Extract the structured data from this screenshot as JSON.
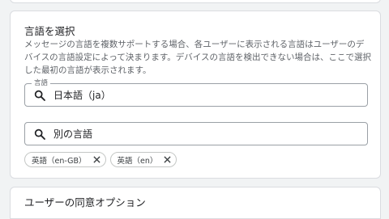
{
  "section": {
    "title": "言語を選択",
    "description": "メッセージの言語を複数サポートする場合、各ユーザーに表示される言語はユーザーのデバイスの言語設定によって決まります。デバイスの言語を検出できない場合は、ここで選択した最初の言語が表示されます。",
    "primary_field": {
      "label": "言語",
      "value": "日本語（ja）"
    },
    "secondary_field": {
      "value": "別の言語"
    },
    "chips": [
      {
        "label": "英語（en-GB）"
      },
      {
        "label": "英語（en）"
      }
    ]
  },
  "next_section": {
    "title": "ユーザーの同意オプション"
  },
  "colors": {
    "page_background": "#f1f3f4",
    "card_background": "#ffffff",
    "border": "#dadce0",
    "text_primary": "#202124",
    "text_secondary": "#5f6368"
  },
  "icons": {
    "search": "search-icon",
    "remove": "close-icon"
  }
}
